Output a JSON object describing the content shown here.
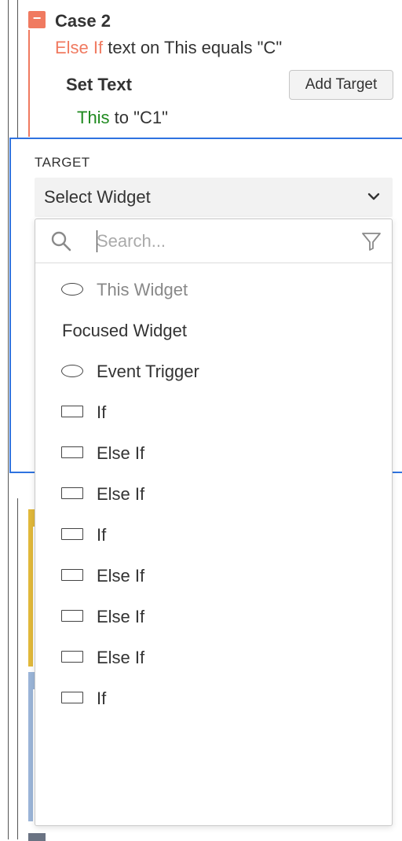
{
  "case": {
    "title": "Case 2",
    "toggle": "−",
    "condition_keyword": "Else If",
    "condition_text": " text on This equals \"C\""
  },
  "action": {
    "title": "Set Text",
    "add_target_label": "Add Target",
    "target_keyword": "This",
    "value_text": " to \"C1\""
  },
  "target_panel": {
    "label": "TARGET",
    "select_value": "Select Widget"
  },
  "dropdown": {
    "search_placeholder": "Search...",
    "options": [
      {
        "label": "This Widget",
        "icon": "oval",
        "disabled": true
      },
      {
        "label": "Focused Widget",
        "icon": "none",
        "disabled": false
      },
      {
        "label": "Event Trigger",
        "icon": "oval",
        "disabled": false
      },
      {
        "label": "If",
        "icon": "rect",
        "disabled": false
      },
      {
        "label": "Else If",
        "icon": "rect",
        "disabled": false
      },
      {
        "label": "Else If",
        "icon": "rect",
        "disabled": false
      },
      {
        "label": "If",
        "icon": "rect",
        "disabled": false
      },
      {
        "label": "Else If",
        "icon": "rect",
        "disabled": false
      },
      {
        "label": "Else If",
        "icon": "rect",
        "disabled": false
      },
      {
        "label": "Else If",
        "icon": "rect",
        "disabled": false
      },
      {
        "label": "If",
        "icon": "rect",
        "disabled": false
      }
    ]
  },
  "colors": {
    "accent_blue": "#2f73e0",
    "case_orange": "#f07a60",
    "this_green": "#1f8a1f",
    "strip_yellow": "#e2b93b",
    "strip_blue": "#9bb5d8"
  }
}
